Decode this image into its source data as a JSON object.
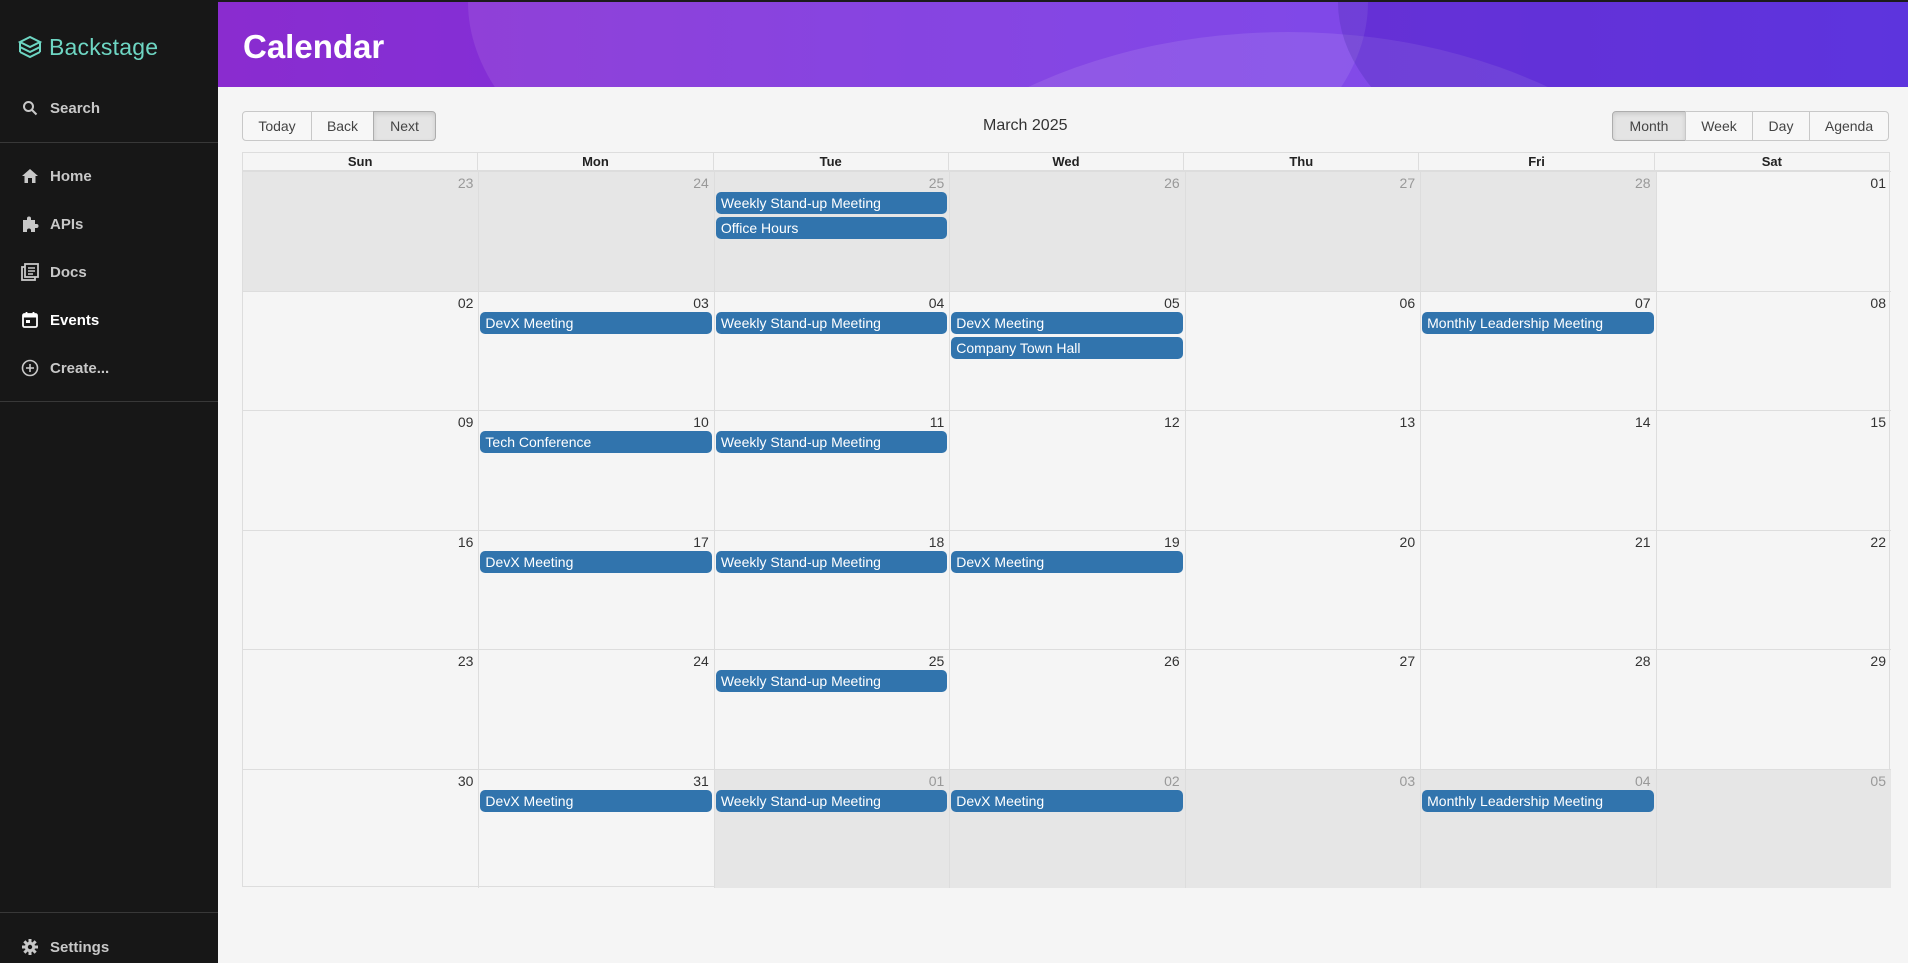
{
  "sidebar": {
    "brand": "Backstage",
    "search_label": "Search",
    "items": [
      {
        "label": "Home",
        "icon": "home-icon"
      },
      {
        "label": "APIs",
        "icon": "puzzle-icon"
      },
      {
        "label": "Docs",
        "icon": "library-icon"
      },
      {
        "label": "Events",
        "icon": "calendar-icon",
        "active": true
      },
      {
        "label": "Create...",
        "icon": "plus-circle-icon"
      }
    ],
    "settings_label": "Settings"
  },
  "header": {
    "title": "Calendar"
  },
  "toolbar": {
    "nav": [
      "Today",
      "Back",
      "Next"
    ],
    "month_label": "March 2025",
    "views": [
      "Month",
      "Week",
      "Day",
      "Agenda"
    ],
    "active_view": "Month",
    "active_nav": "Next"
  },
  "calendar": {
    "days_of_week": [
      "Sun",
      "Mon",
      "Tue",
      "Wed",
      "Thu",
      "Fri",
      "Sat"
    ],
    "weeks": [
      [
        "23",
        "24",
        "25",
        "26",
        "27",
        "28",
        "01"
      ],
      [
        "02",
        "03",
        "04",
        "05",
        "06",
        "07",
        "08"
      ],
      [
        "09",
        "10",
        "11",
        "12",
        "13",
        "14",
        "15"
      ],
      [
        "16",
        "17",
        "18",
        "19",
        "20",
        "21",
        "22"
      ],
      [
        "23",
        "24",
        "25",
        "26",
        "27",
        "28",
        "29"
      ],
      [
        "30",
        "31",
        "01",
        "02",
        "03",
        "04",
        "05"
      ]
    ],
    "outside_month": [
      [
        true,
        true,
        true,
        true,
        true,
        true,
        false
      ],
      [
        false,
        false,
        false,
        false,
        false,
        false,
        false
      ],
      [
        false,
        false,
        false,
        false,
        false,
        false,
        false
      ],
      [
        false,
        false,
        false,
        false,
        false,
        false,
        false
      ],
      [
        false,
        false,
        false,
        false,
        false,
        false,
        false
      ],
      [
        false,
        false,
        true,
        true,
        true,
        true,
        true
      ]
    ],
    "events": [
      {
        "week": 0,
        "day": 2,
        "title": "Weekly Stand-up Meeting"
      },
      {
        "week": 0,
        "day": 2,
        "title": "Office Hours"
      },
      {
        "week": 1,
        "day": 1,
        "title": "DevX Meeting"
      },
      {
        "week": 1,
        "day": 2,
        "title": "Weekly Stand-up Meeting"
      },
      {
        "week": 1,
        "day": 3,
        "title": "DevX Meeting"
      },
      {
        "week": 1,
        "day": 3,
        "title": "Company Town Hall"
      },
      {
        "week": 1,
        "day": 5,
        "title": "Monthly Leadership Meeting"
      },
      {
        "week": 2,
        "day": 1,
        "title": "Tech Conference"
      },
      {
        "week": 2,
        "day": 2,
        "title": "Weekly Stand-up Meeting"
      },
      {
        "week": 3,
        "day": 1,
        "title": "DevX Meeting"
      },
      {
        "week": 3,
        "day": 2,
        "title": "Weekly Stand-up Meeting"
      },
      {
        "week": 3,
        "day": 3,
        "title": "DevX Meeting"
      },
      {
        "week": 4,
        "day": 2,
        "title": "Weekly Stand-up Meeting"
      },
      {
        "week": 5,
        "day": 1,
        "title": "DevX Meeting"
      },
      {
        "week": 5,
        "day": 2,
        "title": "Weekly Stand-up Meeting"
      },
      {
        "week": 5,
        "day": 3,
        "title": "DevX Meeting"
      },
      {
        "week": 5,
        "day": 5,
        "title": "Monthly Leadership Meeting"
      }
    ]
  },
  "colors": {
    "event": "#3174ad",
    "brand": "#6ed6c3",
    "sidebar_bg": "#171717",
    "header_gradient_start": "#8a2ccf",
    "header_gradient_end": "#6a3bf0"
  }
}
